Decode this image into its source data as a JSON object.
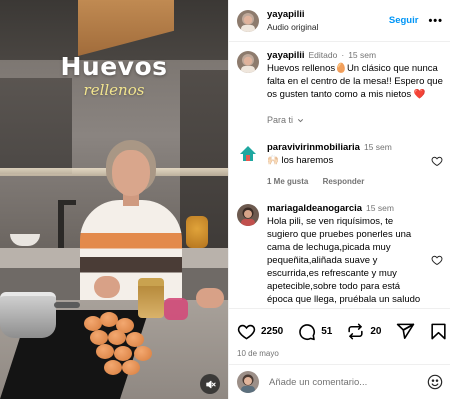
{
  "video": {
    "overlay_title": "Huevos",
    "overlay_subtitle": "rellenos",
    "mute_icon": "muted-speaker-icon"
  },
  "post": {
    "username": "yayapilii",
    "audio_label": "Audio original",
    "follow_label": "Seguir",
    "more_icon": "more-horizontal-icon"
  },
  "caption": {
    "username": "yayapilii",
    "edited_label": "Editado",
    "separator": "·",
    "age": "15 sem",
    "text": "Huevos rellenos🥚Un clásico que nunca falta en el centro de la mesa!! Espero que os gusten tanto como a mis nietos ❤️",
    "translate_label": "Para ti"
  },
  "comments": [
    {
      "username": "paravivirinmobiliaria",
      "age": "15 sem",
      "text": "🙌🏻 los haremos",
      "likes_label": "1 Me gusta",
      "reply_label": "Responder"
    },
    {
      "username": "mariagaldeanogarcia",
      "age": "15 sem",
      "text": "Hola pili, se ven riquísimos, te sugiero que pruebes ponerles una cama de lechuga,picada muy pequeñita,aliñada suave y escurrida,es refrescante y muy apetecible,sobre todo para está época que llega, pruébala un saludo desde Estepona❤️😍"
    }
  ],
  "stats": {
    "likes": "2250",
    "comments": "51",
    "reposts": "20"
  },
  "date": "10 de mayo",
  "composer": {
    "placeholder": "Añade un comentario..."
  },
  "colors": {
    "accent": "#0095f6",
    "secondary_text": "#737373",
    "divider": "#efefef"
  }
}
